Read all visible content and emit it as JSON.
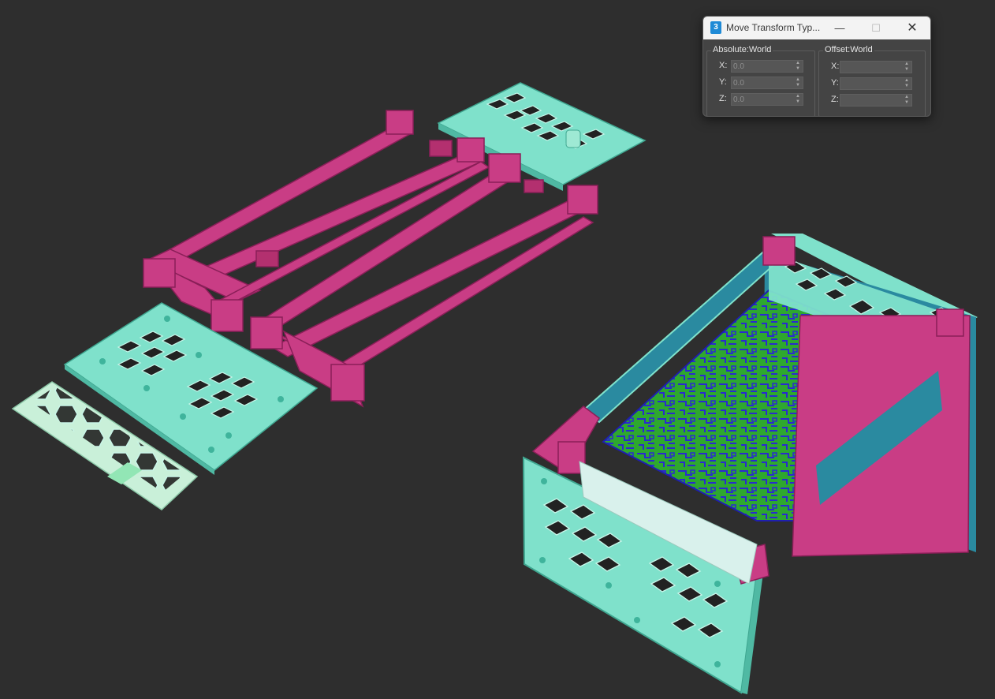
{
  "dialog": {
    "title": "Move Transform Typ...",
    "app_icon": "3",
    "controls": {
      "minimize": "—",
      "maximize": "☐",
      "close": "✕"
    },
    "absolute": {
      "label": "Absolute:World",
      "x_label": "X:",
      "y_label": "Y:",
      "z_label": "Z:",
      "x": "0.0",
      "y": "0.0",
      "z": "0.0"
    },
    "offset": {
      "label": "Offset:World",
      "x_label": "X:",
      "y_label": "Y:",
      "z_label": "Z:",
      "x": "",
      "y": "",
      "z": ""
    }
  },
  "viewport": {
    "background": "#2e2e2e",
    "colors": {
      "frame": "#c93d85",
      "panel": "#7fe1cb",
      "mesh_panel": "#c9f0d9",
      "pcb": "#2ea82f",
      "pcb_traces": "#2a2ad0",
      "enclosure_side": "#2a8aa0"
    }
  }
}
